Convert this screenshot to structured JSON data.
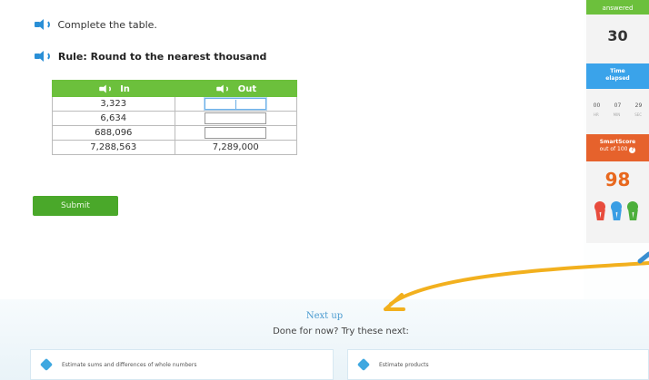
{
  "question": {
    "instruction": "Complete the table.",
    "rule": "Rule: Round to the nearest thousand"
  },
  "table": {
    "headers": [
      "In",
      "Out"
    ],
    "rows": [
      {
        "in": "3,323",
        "out": ""
      },
      {
        "in": "6,634",
        "out": ""
      },
      {
        "in": "688,096",
        "out": ""
      },
      {
        "in": "7,288,563",
        "out": "7,289,000"
      }
    ]
  },
  "submit_label": "Submit",
  "sidebar": {
    "answered_label": "answered",
    "answered_count": "30",
    "time_elapsed_line1": "Time",
    "time_elapsed_line2": "elapsed",
    "clock": {
      "hr": "00",
      "min": "07",
      "sec": "29"
    },
    "clock_labels": {
      "hr": "HR",
      "min": "MIN",
      "sec": "SEC"
    },
    "smartscore_line1": "SmartScore",
    "smartscore_line2": "out of 100",
    "info_glyph": "?",
    "smartscore_value": "98",
    "ribbon_colors": [
      "#e84c3d",
      "#3a9ee4",
      "#4caf3c"
    ]
  },
  "next_up": {
    "heading": "Next up",
    "subtext": "Done for now? Try these next:",
    "suggestions": [
      {
        "label": "Estimate sums and differences of whole numbers"
      },
      {
        "label": "Estimate products"
      }
    ]
  },
  "colors": {
    "green": "#6cc03c",
    "submit_green": "#4aa82a",
    "blue": "#3aa3ea",
    "orange": "#e6622c",
    "arrow": "#f2b01e"
  }
}
